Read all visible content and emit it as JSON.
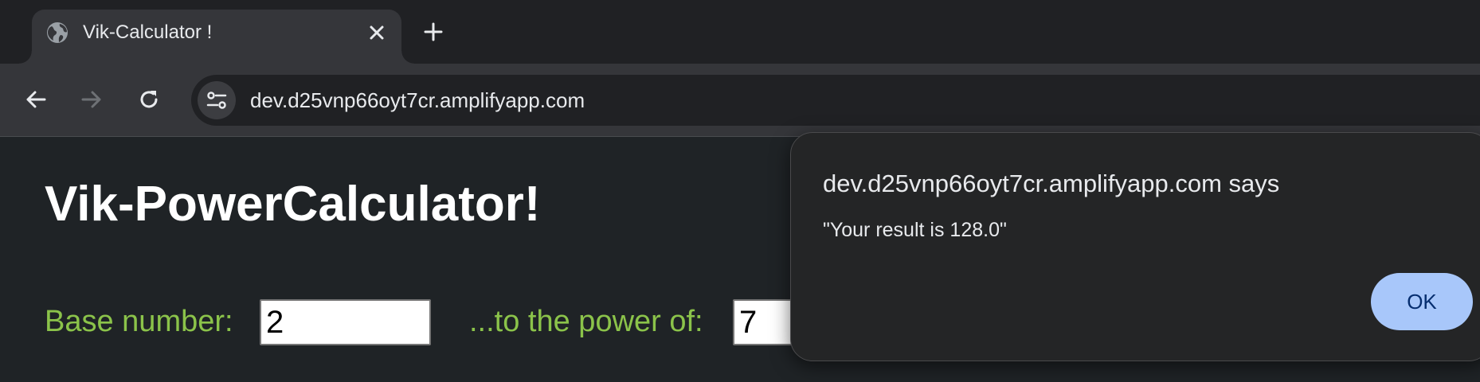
{
  "browser": {
    "tab": {
      "title": "Vik-Calculator !",
      "icon": "globe-icon"
    },
    "new_tab_icon": "plus-icon",
    "toolbar": {
      "back_icon": "arrow-left-icon",
      "forward_icon": "arrow-right-icon",
      "reload_icon": "reload-icon",
      "site_info_icon": "tune-icon",
      "url": "dev.d25vnp66oyt7cr.amplifyapp.com"
    }
  },
  "page": {
    "title": "Vik-PowerCalculator!",
    "base": {
      "label": "Base number:",
      "value": "2"
    },
    "power": {
      "label": "...to the power of:",
      "value": "7"
    }
  },
  "dialog": {
    "title": "dev.d25vnp66oyt7cr.amplifyapp.com says",
    "message": "\"Your result is 128.0\"",
    "ok_label": "OK"
  },
  "colors": {
    "label_accent": "#8bc34a",
    "ok_button": "#a8c7fa",
    "page_background": "#1f2326"
  }
}
